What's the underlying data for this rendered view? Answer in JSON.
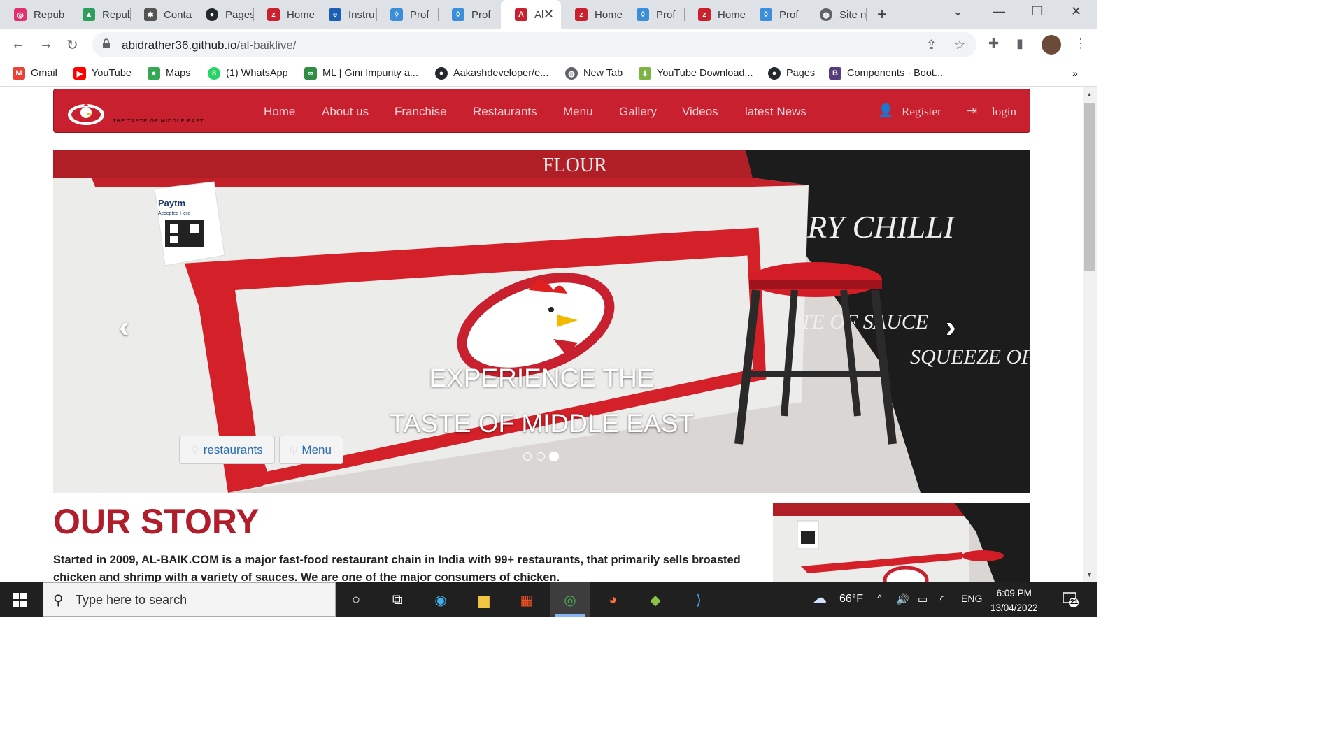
{
  "browser": {
    "tabs": [
      {
        "label": "Repub",
        "icon": "instagram-icon",
        "color": "#e1306c"
      },
      {
        "label": "Repub",
        "icon": "leaf-icon",
        "color": "#2e9e5b"
      },
      {
        "label": "Conta",
        "icon": "settings-icon",
        "color": "#555555"
      },
      {
        "label": "Pages",
        "icon": "github-icon",
        "color": "#24292e"
      },
      {
        "label": "Home",
        "icon": "zomato-icon",
        "color": "#cb202d"
      },
      {
        "label": "Instru",
        "icon": "educba-icon",
        "color": "#1a5fb4"
      },
      {
        "label": "Prof",
        "icon": "drop-icon",
        "color": "#3b8fd9"
      },
      {
        "label": "Prof",
        "icon": "drop-icon",
        "color": "#3b8fd9"
      },
      {
        "label": "Al",
        "icon": "albaik-icon",
        "color": "#c8202f"
      },
      {
        "label": "Home",
        "icon": "zomato-icon",
        "color": "#cb202d"
      },
      {
        "label": "Prof",
        "icon": "drop-icon",
        "color": "#3b8fd9"
      },
      {
        "label": "Home",
        "icon": "zomato-icon",
        "color": "#cb202d"
      },
      {
        "label": "Prof",
        "icon": "drop-icon",
        "color": "#3b8fd9"
      },
      {
        "label": "Site n",
        "icon": "globe-icon",
        "color": "#5f6368"
      }
    ],
    "url_host": "abidrather36.github.io",
    "url_path": "/al-baiklive/",
    "bookmarks": [
      {
        "label": "Gmail",
        "icon": "gmail-icon",
        "color": "#ea4335"
      },
      {
        "label": "YouTube",
        "icon": "youtube-icon",
        "color": "#ff0000"
      },
      {
        "label": "Maps",
        "icon": "maps-icon",
        "color": "#34a853"
      },
      {
        "label": "(1) WhatsApp",
        "icon": "whatsapp-icon",
        "color": "#25d366"
      },
      {
        "label": "ML | Gini Impurity a...",
        "icon": "geeksforgeeks-icon",
        "color": "#2f8d46"
      },
      {
        "label": "Aakashdeveloper/e...",
        "icon": "github-icon",
        "color": "#24292e"
      },
      {
        "label": "New Tab",
        "icon": "globe-icon",
        "color": "#5f6368"
      },
      {
        "label": "YouTube Download...",
        "icon": "download-icon",
        "color": "#7cb342"
      },
      {
        "label": "Pages",
        "icon": "github-icon",
        "color": "#24292e"
      },
      {
        "label": "Components · Boot...",
        "icon": "bootstrap-icon",
        "color": "#563d7c"
      }
    ]
  },
  "site": {
    "logo_tagline": "THE TASTE OF MIDDLE EAST",
    "nav": [
      "Home",
      "About us",
      "Franchise",
      "Restaurants",
      "Menu",
      "Gallery",
      "Videos",
      "latest News"
    ],
    "register": "Register",
    "login": "login",
    "carousel": {
      "caption_line1": "EXPERIENCE THE",
      "caption_line2": "TASTE OF MIDDLE EAST",
      "btn_restaurants": "restaurants",
      "btn_menu": "Menu",
      "slide_count": 3,
      "active_slide": 3,
      "sign_paytm": "Paytm",
      "sign_paytm_sub": "Accepted Here",
      "wall_text_1": "FLOUR",
      "wall_text_2": "ERY CHILLI",
      "wall_text_3": "TASTE OF SAUCE",
      "wall_text_4": "SQUEEZE OF DRESSING"
    },
    "story_title": "OUR STORY",
    "story_text": "Started in 2009, AL-BAIK.COM is a major fast-food restaurant chain in India with 99+ restaurants, that primarily sells broasted chicken and shrimp with a variety of sauces. We are one of the major consumers of chicken."
  },
  "taskbar": {
    "search_placeholder": "Type here to search",
    "weather": "66°F",
    "language": "ENG",
    "time": "6:09 PM",
    "date": "13/04/2022",
    "notifications": "21"
  },
  "colors": {
    "brand_red": "#c8202f",
    "story_red": "#b01e2c"
  }
}
